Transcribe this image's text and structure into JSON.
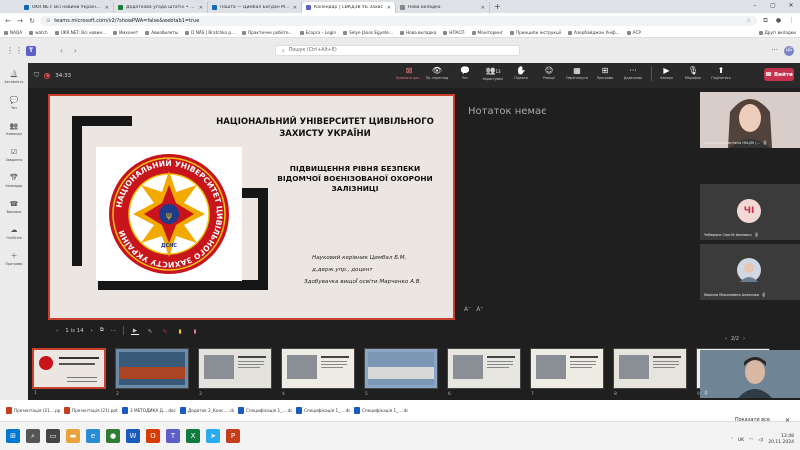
{
  "browser": {
    "tabs": [
      {
        "label": "UKR.NET: Всі новини України, о",
        "color": "#0d68b5",
        "active": false
      },
      {
        "label": "Додаткова угода штатні • тем",
        "color": "#188038",
        "active": false
      },
      {
        "label": "Пошта — Цимбал Богдан Мико",
        "color": "#0f6cbd",
        "active": false
      },
      {
        "label": "Календар | СВКДЗВ УБ Захис",
        "color": "#5b5fc7",
        "active": true
      },
      {
        "label": "Нова вкладка",
        "color": "#888888",
        "active": false
      }
    ],
    "new_tab": "+",
    "url": "teams.microsoft.com/v2/?showPWA=false&webtab1=true",
    "bookmarks": [
      "NAQA",
      "watch",
      "UKR.NET: Всі новин...",
      "Имхонет",
      "Авиабилеты",
      "D NÄS | Bratchko p...",
      "Практичне роботе...",
      "Ecopra – Login",
      "Selye János Egyete...",
      "Нова вкладка",
      "НПАСП",
      "Моніторинг",
      "Принципи інструкції",
      "Азербайджан Уніф...",
      "АСР"
    ],
    "other_bookmarks": "Другі вкладки"
  },
  "teams": {
    "search_placeholder": "Пошук (Ctrl+Alt+E)",
    "avatar": "ЦБ",
    "rail": [
      {
        "label": "Активність",
        "icon": "bell-icon"
      },
      {
        "label": "Чат",
        "icon": "chat-icon"
      },
      {
        "label": "Команди",
        "icon": "teams-icon"
      },
      {
        "label": "Завдання",
        "icon": "tasks-icon"
      },
      {
        "label": "Календар",
        "icon": "calendar-icon"
      },
      {
        "label": "Виклики",
        "icon": "phone-icon"
      },
      {
        "label": "OneDrive",
        "icon": "cloud-icon"
      },
      {
        "label": "Програми",
        "icon": "apps-icon"
      }
    ]
  },
  "meeting": {
    "timer": "34:33",
    "actions": [
      {
        "label": "Зупинити дос...",
        "icon": "stop-share-icon",
        "stop": true
      },
      {
        "label": "Пр. перегляд",
        "icon": "eye-icon",
        "stop": false
      },
      {
        "label": "Чат",
        "icon": "chat-icon",
        "stop": false
      },
      {
        "label": "Користувачі",
        "icon": "people-icon",
        "stop": false,
        "badge": "13"
      },
      {
        "label": "Підняти",
        "icon": "hand-icon",
        "stop": false
      },
      {
        "label": "Реакції",
        "icon": "emoji-icon",
        "stop": false
      },
      {
        "label": "Переглянути",
        "icon": "view-icon",
        "stop": false
      },
      {
        "label": "Програми",
        "icon": "apps-icon",
        "stop": false
      },
      {
        "label": "Додатково",
        "icon": "more-icon",
        "stop": false
      }
    ],
    "devices": [
      {
        "label": "Камера",
        "icon": "camera-icon"
      },
      {
        "label": "Мікрофон",
        "icon": "mic-off-icon"
      },
      {
        "label": "Поділитися",
        "icon": "share-icon"
      }
    ],
    "leave_label": "Вийти",
    "notes": "Нотаток немає",
    "zoom": [
      "A⁻",
      "A⁺"
    ],
    "page_indicator": "1 із 14",
    "thumb_numbers": [
      "1",
      "2",
      "3",
      "4",
      "5",
      "6",
      "7",
      "8",
      "9"
    ],
    "thumb_9_text": "РОБОТА НА ВИСОКИХ МЕТАЛІЧНИХ"
  },
  "slide": {
    "title_line1": "НАЦІОНАЛЬНИЙ  УНІВЕРСИТЕТ ЦИВІЛЬНОГО",
    "title_line2": "ЗАХИСТУ УКРАЇНИ",
    "sub1": "ПІДВИЩЕННЯ РІВНЯ БЕЗПЕКИ",
    "sub2": "ВІДОМЧОЇ ВОЄНІЗОВАНОЇ ОХОРОНИ",
    "sub3": "ЗАЛІЗНИЦІ",
    "author1": "Науковий керівник Цимбал Б.М,",
    "author2": "д.держ.упр., доцент",
    "author3": "Здобувачка вищоЇ освіти Марченко А.В.",
    "logo_ring_text": "НАЦІОНАЛЬНИЙ УНІВЕРСИТЕТ ЦИВІЛЬНОГО ЗАХИСТУ УКРАЇНИ",
    "logo_small": "ДСНС"
  },
  "participants": {
    "p1": "Марченко Анастасія НУЦЗУ (...",
    "p2_initials": "ЧІ",
    "p2": "Чеберяко Сергій Іванович",
    "p3": "Марина Миколаївна Алексова",
    "pager": "2/2"
  },
  "downloads": {
    "items": [
      {
        "name": "Презентація (21....pptx",
        "color": "#c43e1c"
      },
      {
        "name": "Презентація (21).pptx",
        "color": "#c43e1c"
      },
      {
        "name": "3 МЕТОДИКА Д....docx",
        "color": "#185abd"
      },
      {
        "name": "Додаток 2_Конс.....docx",
        "color": "#185abd"
      },
      {
        "name": "Специфікація 1_....docx",
        "color": "#185abd"
      },
      {
        "name": "Специфікація 1_....docx",
        "color": "#185abd"
      },
      {
        "name": "Специфікація 1_....docx",
        "color": "#185abd"
      }
    ],
    "show_all": "Показати все"
  },
  "taskbar": {
    "apps": [
      {
        "color": "#0078d4",
        "icon": "windows-icon",
        "glyph": "⊞"
      },
      {
        "color": "#555555",
        "icon": "search-icon",
        "glyph": "⌕"
      },
      {
        "color": "#444444",
        "icon": "taskview-icon",
        "glyph": "▭"
      },
      {
        "color": "#e8a33d",
        "icon": "folder-icon",
        "glyph": "▬"
      },
      {
        "color": "#2a8dd4",
        "icon": "edge-icon",
        "glyph": "e"
      },
      {
        "color": "#2e7d32",
        "icon": "chrome-icon",
        "glyph": "●"
      },
      {
        "color": "#185abd",
        "icon": "word-icon",
        "glyph": "W"
      },
      {
        "color": "#d83b01",
        "icon": "opera-icon",
        "glyph": "O"
      },
      {
        "color": "#5b5fc7",
        "icon": "teams-icon",
        "glyph": "T"
      },
      {
        "color": "#107c41",
        "icon": "excel-icon",
        "glyph": "X"
      },
      {
        "color": "#2aabee",
        "icon": "telegram-icon",
        "glyph": "➤"
      },
      {
        "color": "#c43e1c",
        "icon": "powerpoint-icon",
        "glyph": "P"
      }
    ],
    "lang": "UK",
    "time": "13:48",
    "date": "20.11.2024"
  }
}
